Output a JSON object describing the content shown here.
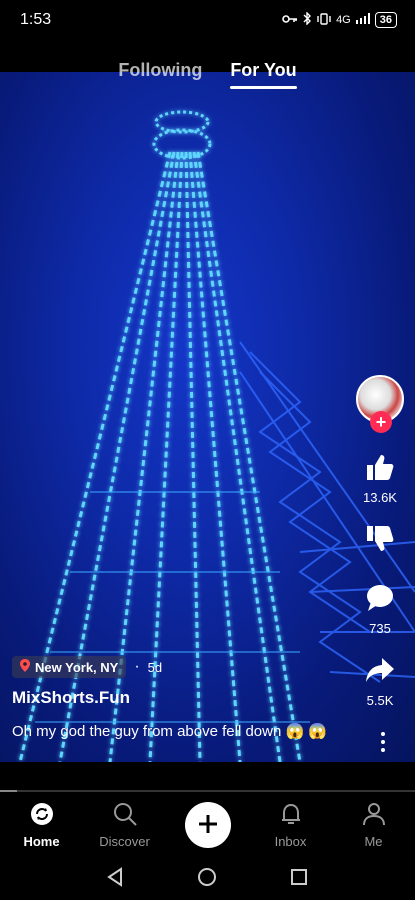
{
  "status_bar": {
    "time": "1:53",
    "network": "4G",
    "battery": "36"
  },
  "tabs": {
    "following": "Following",
    "for_you": "For You"
  },
  "creator": {
    "location": "New York, NY",
    "age": "5d",
    "username": "MixShorts.Fun"
  },
  "caption": "Oh my god the guy from above fell down 😱 😱",
  "actions": {
    "likes": "13.6K",
    "comments": "735",
    "shares": "5.5K"
  },
  "progress": {
    "fraction": 0.04
  },
  "nav": {
    "home": "Home",
    "discover": "Discover",
    "inbox": "Inbox",
    "me": "Me"
  },
  "icons": [
    "key-icon",
    "bluetooth-icon",
    "vibrate-icon",
    "signal-icon",
    "battery-icon",
    "location-pin-icon",
    "thumbs-up-icon",
    "thumbs-down-icon",
    "comment-icon",
    "share-icon",
    "home-icon",
    "search-icon",
    "plus-icon",
    "bell-icon",
    "profile-icon",
    "back-icon",
    "home-circle-icon",
    "recents-icon"
  ],
  "colors": {
    "accent": "#ff2b55",
    "glow": "#5fd6ff"
  }
}
